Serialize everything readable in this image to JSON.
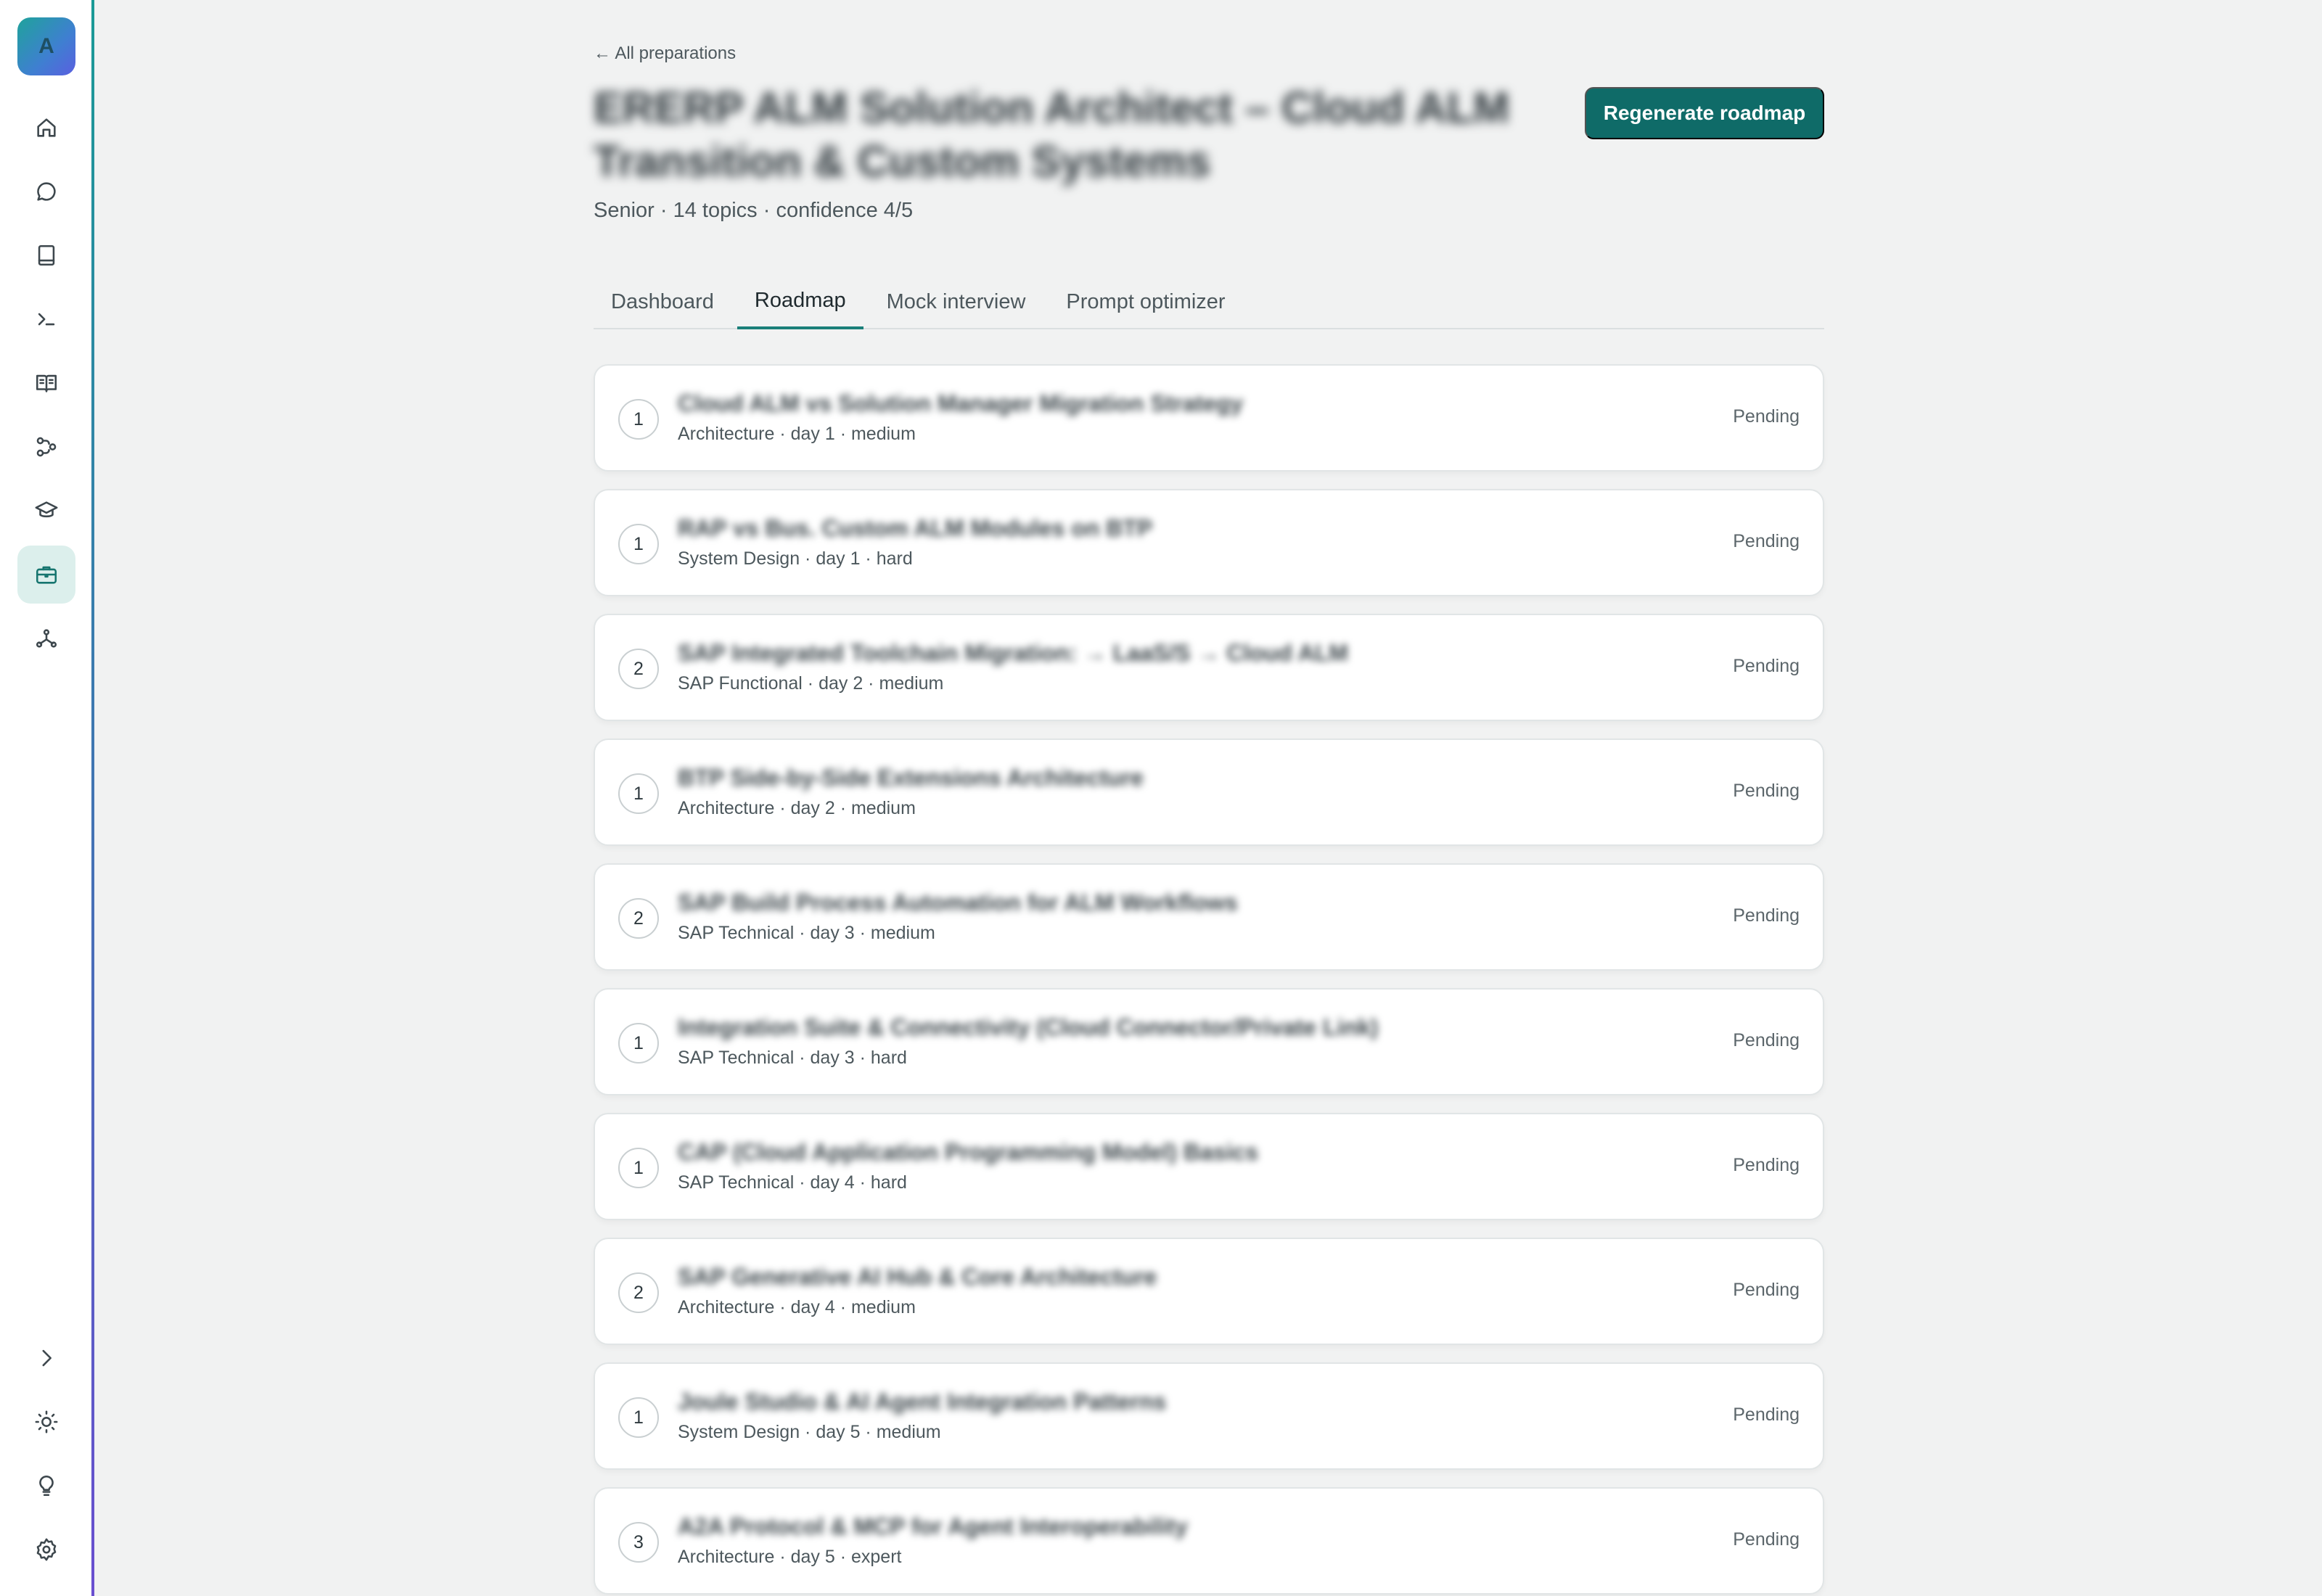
{
  "sidebar": {
    "avatar_initial": "A",
    "accent_colors": [
      "#1a9a96",
      "#6a4fd0"
    ],
    "items": [
      {
        "name": "home-icon"
      },
      {
        "name": "chat-icon"
      },
      {
        "name": "notebook-icon"
      },
      {
        "name": "terminal-icon"
      },
      {
        "name": "book-open-icon"
      },
      {
        "name": "workflow-icon"
      },
      {
        "name": "graduation-cap-icon"
      },
      {
        "name": "briefcase-icon",
        "active": true
      },
      {
        "name": "network-icon"
      }
    ],
    "bottom_items": [
      {
        "name": "chevron-right-icon"
      },
      {
        "name": "sun-icon"
      },
      {
        "name": "lightbulb-icon"
      },
      {
        "name": "settings-icon"
      }
    ]
  },
  "header": {
    "back_link": "← All preparations",
    "title": "ERERP ALM Solution Architect – Cloud ALM Transition & Custom Systems",
    "regenerate_label": "Regenerate roadmap",
    "subtitle": "Senior · 14 topics · confidence 4/5",
    "brand_color": "#0f6b68"
  },
  "tabs": [
    {
      "label": "Dashboard",
      "active": false
    },
    {
      "label": "Roadmap",
      "active": true
    },
    {
      "label": "Mock interview",
      "active": false
    },
    {
      "label": "Prompt optimizer",
      "active": false
    }
  ],
  "roadmap": [
    {
      "num": "1",
      "title": "Cloud ALM vs Solution Manager Migration Strategy",
      "meta": "Architecture · day 1 · medium",
      "status": "Pending"
    },
    {
      "num": "1",
      "title": "RAP vs Bus. Custom ALM Modules on BTP",
      "meta": "System Design · day 1 · hard",
      "status": "Pending"
    },
    {
      "num": "2",
      "title": "SAP Integrated Toolchain Migration: → LaaS/S → Cloud ALM",
      "meta": "SAP Functional · day 2 · medium",
      "status": "Pending"
    },
    {
      "num": "1",
      "title": "BTP Side-by-Side Extensions Architecture",
      "meta": "Architecture · day 2 · medium",
      "status": "Pending"
    },
    {
      "num": "2",
      "title": "SAP Build Process Automation for ALM Workflows",
      "meta": "SAP Technical · day 3 · medium",
      "status": "Pending"
    },
    {
      "num": "1",
      "title": "Integration Suite & Connectivity (Cloud Connector/Private Link)",
      "meta": "SAP Technical · day 3 · hard",
      "status": "Pending"
    },
    {
      "num": "1",
      "title": "CAP (Cloud Application Programming Model) Basics",
      "meta": "SAP Technical · day 4 · hard",
      "status": "Pending"
    },
    {
      "num": "2",
      "title": "SAP Generative AI Hub & Core Architecture",
      "meta": "Architecture · day 4 · medium",
      "status": "Pending"
    },
    {
      "num": "1",
      "title": "Joule Studio & AI Agent Integration Patterns",
      "meta": "System Design · day 5 · medium",
      "status": "Pending"
    },
    {
      "num": "3",
      "title": "A2A Protocol & MCP for Agent Interoperability",
      "meta": "Architecture · day 5 · expert",
      "status": "Pending"
    }
  ]
}
